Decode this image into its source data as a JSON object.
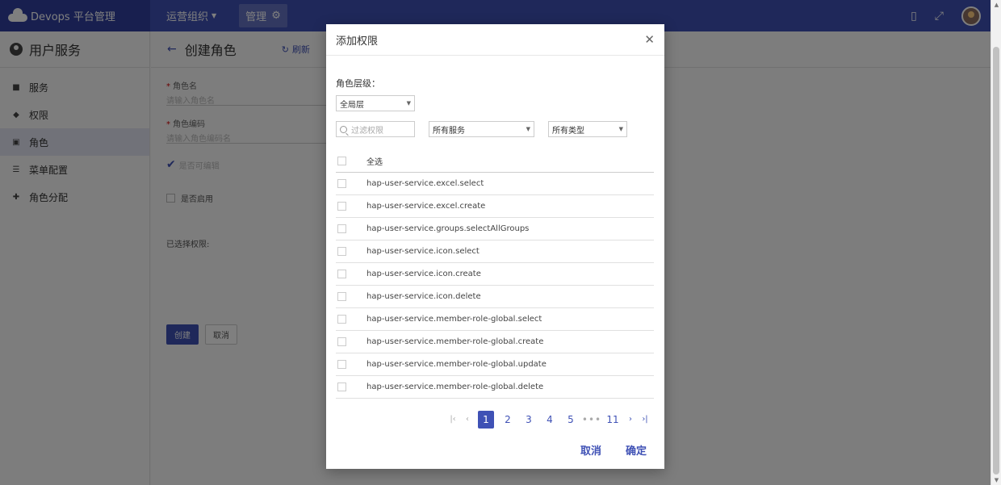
{
  "topbar": {
    "brand": "Devops 平台管理",
    "org_label": "运营组织",
    "manage_label": "管理"
  },
  "sidebar": {
    "title": "用户服务",
    "items": [
      {
        "label": "服务",
        "icon": "briefcase-icon"
      },
      {
        "label": "权限",
        "icon": "shield-icon"
      },
      {
        "label": "角色",
        "icon": "id-card-icon",
        "active": true
      },
      {
        "label": "菜单配置",
        "icon": "list-icon"
      },
      {
        "label": "角色分配",
        "icon": "add-person-icon"
      }
    ]
  },
  "content": {
    "title": "创建角色",
    "refresh_label": "刷新",
    "role_name_label": "角色名",
    "role_name_placeholder": "请输入角色名",
    "role_code_label": "角色编码",
    "role_code_placeholder": "请输入角色编码名",
    "editable_label": "是否可编辑",
    "enabled_label": "是否启用",
    "selected_permissions_label": "已选择权限:",
    "create_label": "创建",
    "cancel_label": "取消"
  },
  "modal": {
    "title": "添加权限",
    "level_label": "角色层级：",
    "level_value": "全局层",
    "filter_placeholder": "过滤权限",
    "service_value": "所有服务",
    "type_value": "所有类型",
    "select_all_label": "全选",
    "permissions": [
      "hap-user-service.excel.select",
      "hap-user-service.excel.create",
      "hap-user-service.groups.selectAllGroups",
      "hap-user-service.icon.select",
      "hap-user-service.icon.create",
      "hap-user-service.icon.delete",
      "hap-user-service.member-role-global.select",
      "hap-user-service.member-role-global.create",
      "hap-user-service.member-role-global.update",
      "hap-user-service.member-role-global.delete"
    ],
    "pagination": {
      "pages": [
        "1",
        "2",
        "3",
        "4",
        "5"
      ],
      "current": "1",
      "ellipsis": "•••",
      "last": "11"
    },
    "cancel_label": "取消",
    "confirm_label": "确定"
  },
  "colors": {
    "primary": "#3f51b5",
    "primary_dark": "#303f9f"
  }
}
